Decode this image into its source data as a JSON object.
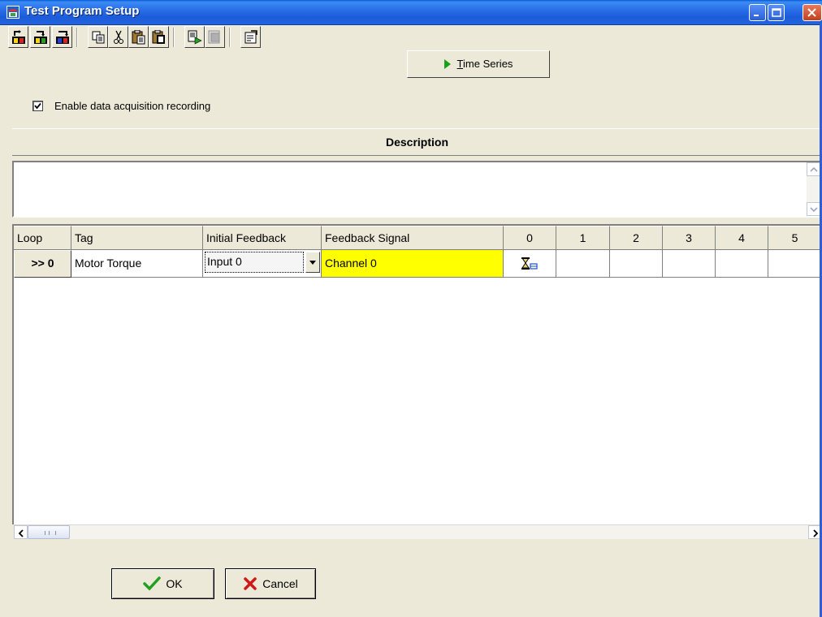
{
  "window": {
    "title": "Test Program Setup",
    "icon": "app-window-icon",
    "controls": [
      "minimize-icon",
      "maximize-icon",
      "close-icon"
    ]
  },
  "toolbar": {
    "buttons": [
      {
        "name": "import-button",
        "icon": "import-icon"
      },
      {
        "name": "open-button",
        "icon": "open-icon"
      },
      {
        "name": "export-button",
        "icon": "export-icon"
      },
      {
        "name": "copy-button",
        "icon": "copy-icon"
      },
      {
        "name": "cut-button",
        "icon": "cut-icon"
      },
      {
        "name": "paste-button",
        "icon": "paste-icon"
      },
      {
        "name": "paste-special-button",
        "icon": "paste-special-icon"
      },
      {
        "name": "run-button",
        "icon": "run-icon"
      },
      {
        "name": "stop-button",
        "icon": "stop-icon"
      },
      {
        "name": "properties-button",
        "icon": "properties-icon"
      }
    ],
    "time_series_label": "Time Series",
    "time_series_accel": "T"
  },
  "recording": {
    "label": "Enable data acquisition recording",
    "checked": true
  },
  "description": {
    "header": "Description",
    "text": ""
  },
  "grid": {
    "columns": [
      "Loop",
      "Tag",
      "Initial Feedback",
      "Feedback Signal",
      "0",
      "1",
      "2",
      "3",
      "4",
      "5"
    ],
    "rows": [
      {
        "loop": ">> 0",
        "tag": "Motor Torque",
        "initial_feedback": "Input 0",
        "feedback_signal": "Channel 0",
        "step_0_icon": "hourglass-segment-icon",
        "highlight_color": "#ffff00"
      }
    ]
  },
  "buttons": {
    "ok": "OK",
    "cancel": "Cancel"
  },
  "colors": {
    "titlebar": "#2163e0",
    "dialog_bg": "#ece9d8",
    "highlight": "#ffff00"
  }
}
